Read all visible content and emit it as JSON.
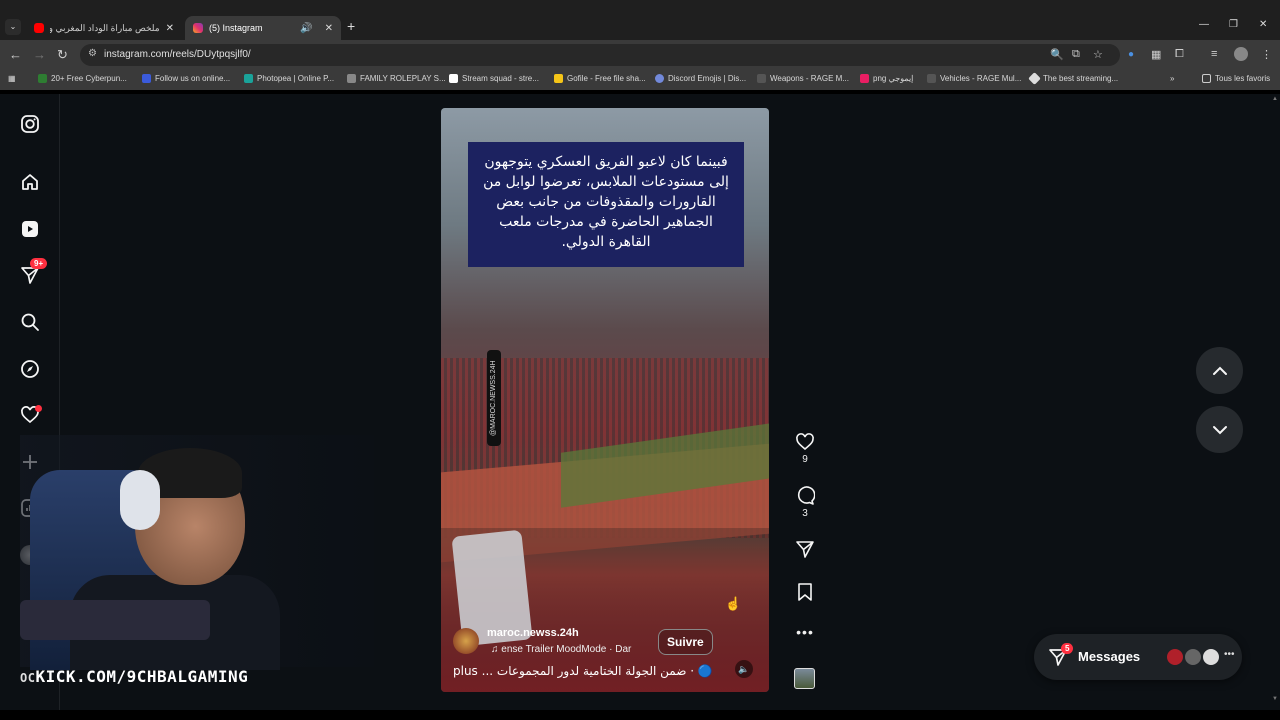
{
  "browser": {
    "tabs": [
      {
        "title": "ملخص مباراة الوداد المغربي وعزا",
        "active": false,
        "favicon_color": "#ff0000"
      },
      {
        "title": "(5) Instagram",
        "active": true,
        "favicon_color": "#e1306c"
      }
    ],
    "url": "instagram.com/reels/DUytpqsjlf0/",
    "bookmarks": [
      {
        "label": "20+ Free Cyberpun...",
        "color": "#2e7d32"
      },
      {
        "label": "Follow us on online...",
        "color": "#3b5bdb"
      },
      {
        "label": "Photopea | Online P...",
        "color": "#1aa39a"
      },
      {
        "label": "FAMILY ROLEPLAY S...",
        "color": "#888888"
      },
      {
        "label": "Stream squad - stre...",
        "color": "#ffffff"
      },
      {
        "label": "Gofile - Free file sha...",
        "color": "#f5c518"
      },
      {
        "label": "Discord Emojis | Dis...",
        "color": "#7289da"
      },
      {
        "label": "Weapons - RAGE M...",
        "color": "#333333"
      },
      {
        "label": "png إيموجي",
        "color": "#e91e63"
      },
      {
        "label": "Vehicles - RAGE Mul...",
        "color": "#333333"
      },
      {
        "label": "The best streaming...",
        "color": "#dddddd"
      }
    ],
    "all_favorites": "Tous les favoris"
  },
  "sidebar": {
    "items": [
      {
        "name": "instagram-logo-icon"
      },
      {
        "name": "home-icon"
      },
      {
        "name": "reels-icon"
      },
      {
        "name": "direct-icon",
        "badge": "9+"
      },
      {
        "name": "search-icon"
      },
      {
        "name": "explore-icon"
      },
      {
        "name": "notifications-icon"
      },
      {
        "name": "create-icon"
      },
      {
        "name": "dashboard-icon"
      },
      {
        "name": "profile-avatar"
      }
    ]
  },
  "reel": {
    "caption": "فبينما كان لاعبو الفريق العسكري يتوجهون إلى مستودعات الملابس، تعرضوا لوابل من القارورات والمقذوفات من جانب بعض الجماهير الحاضرة في مدرجات ملعب القاهرة الدولي.",
    "watermark": "@MAROC.NEWSS.24H",
    "author": "maroc.newss.24h",
    "music": "ense Trailer   MoodMode · Dar",
    "follow_label": "Suivre",
    "description": "plus ... ضمن الجولة الختامية لدور المجموعات · 🔵",
    "likes": "9",
    "comments": "3"
  },
  "messages": {
    "label": "Messages",
    "badge": "5"
  },
  "overlay": {
    "stream_prefix": "OC",
    "stream_url": "KICK.COM/9CHBALGAMING"
  }
}
